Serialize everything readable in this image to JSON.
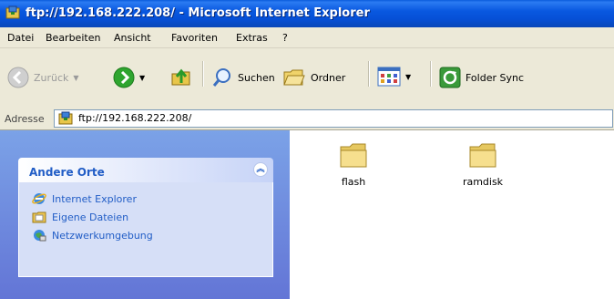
{
  "window": {
    "title": "ftp://192.168.222.208/ - Microsoft Internet Explorer"
  },
  "menu": [
    "Datei",
    "Bearbeiten",
    "Ansicht",
    "Favoriten",
    "Extras",
    "?"
  ],
  "toolbar": {
    "back_label": "Zurück",
    "search_label": "Suchen",
    "folder_label": "Ordner",
    "sync_label": "Folder Sync"
  },
  "address": {
    "label": "Adresse",
    "value": "ftp://192.168.222.208/"
  },
  "sidebar": {
    "panel_title": "Andere Orte",
    "links": [
      "Internet Explorer",
      "Eigene Dateien",
      "Netzwerkumgebung"
    ]
  },
  "files": [
    {
      "name": "flash"
    },
    {
      "name": "ramdisk"
    }
  ]
}
